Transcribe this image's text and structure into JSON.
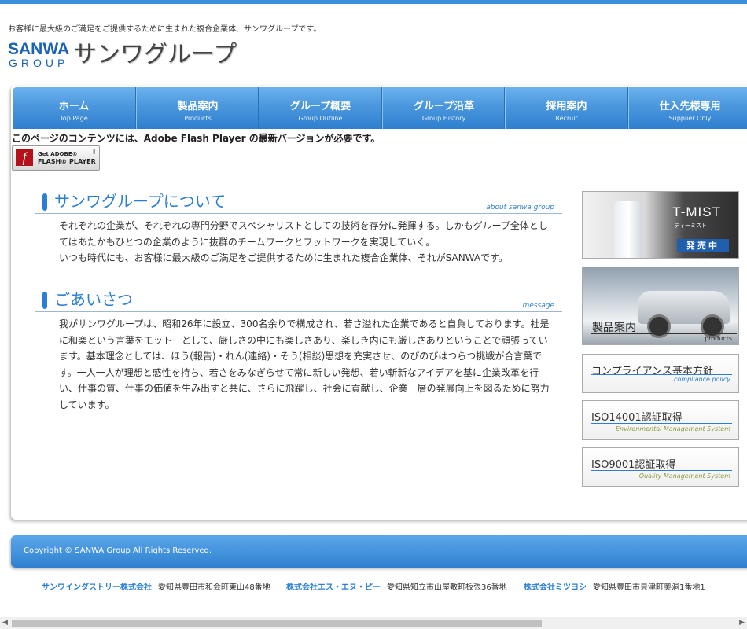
{
  "tagline": "お客様に最大級のご満足をご提供するために生まれた複合企業体、サンワグループです。",
  "logo": {
    "sanwa": "SANWA",
    "group": "GROUP",
    "jp": "サンワグループ"
  },
  "nav": [
    {
      "jp": "ホーム",
      "en": "Top Page"
    },
    {
      "jp": "製品案内",
      "en": "Products"
    },
    {
      "jp": "グループ概要",
      "en": "Group Outline"
    },
    {
      "jp": "グループ沿革",
      "en": "Group History"
    },
    {
      "jp": "採用案内",
      "en": "Recruit"
    },
    {
      "jp": "仕入先様専用",
      "en": "Supplier Only"
    }
  ],
  "flash": {
    "message": "このページのコンテンツには、Adobe Flash Player の最新バージョンが必要です。",
    "get": "Get ADOBE®",
    "player": "FLASH® PLAYER"
  },
  "about": {
    "title": "サンワグループについて",
    "en": "about sanwa group",
    "body1": "それぞれの企業が、それぞれの専門分野でスペシャリストとしての技術を存分に発揮する。しかもグループ全体としてはあたかもひとつの企業のように抜群のチームワークとフットワークを実現していく。",
    "body2": "いつも時代にも、お客様に最大級のご満足をご提供するために生まれた複合企業体、それがSANWAです。"
  },
  "greeting": {
    "title": "ごあいさつ",
    "en": "message",
    "body": "我がサンワグループは、昭和26年に設立、300名余りで構成され、若さ溢れた企業であると自負しております。社是に和楽という言葉をモットーとして、厳しさの中にも楽しさあり、楽しき内にも厳しさありということで頑張っています。基本理念としては、ほう(報告)・れん(連絡)・そう(相談)思想を充実させ、のびのびはつらつ挑戦が合言葉です。一人一人が理想と感性を持ち、若さをみなぎらせて常に新しい発想、若い斬新なアイデアを基に企業改革を行い、仕事の質、仕事の価値を生み出すと共に、さらに飛躍し、社会に貢献し、企業一層の発展向上を図るために努力しています。"
  },
  "banners": {
    "tmist": {
      "name": "T-MIST",
      "kana": "ティーミスト",
      "sale": "発売中"
    },
    "products": {
      "jp": "製品案内",
      "en": "products"
    },
    "compliance": {
      "jp": "コンプライアンス基本方針",
      "en": "compliance policy"
    },
    "iso14001": {
      "jp": "ISO14001認証取得",
      "en": "Environmental Management System"
    },
    "iso9001": {
      "jp": "ISO9001認証取得",
      "en": "Quality Management System"
    }
  },
  "copyright": "Copyright © SANWA Group All Rights Reserved.",
  "companies": [
    {
      "name": "サンワインダストリー株式会社",
      "address": "愛知県豊田市和会町東山48番地"
    },
    {
      "name": "株式会社エス・エヌ・ピー",
      "address": "愛知県知立市山屋敷町板張36番地"
    },
    {
      "name": "株式会社ミツヨシ",
      "address": "愛知県豊田市貝津町奥洞1番地1"
    }
  ],
  "scroll": {
    "left": "◀",
    "right": "▶"
  }
}
